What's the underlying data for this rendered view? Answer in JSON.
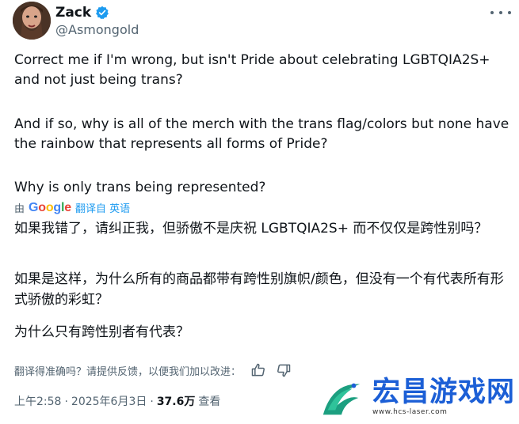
{
  "user": {
    "name": "Zack",
    "handle": "@Asmongold"
  },
  "tweet": {
    "paragraphs": [
      "Correct me if I'm wrong, but isn't Pride about celebrating LGBTQIA2S+ and not just being trans?",
      "And if so, why is all of the merch with the trans flag/colors but none have the rainbow that represents all forms of Pride?",
      "Why is only trans being represented?"
    ]
  },
  "translation": {
    "by_label": "由",
    "provider_letters": [
      "G",
      "o",
      "o",
      "g",
      "l",
      "e"
    ],
    "link_label": "翻译自 英语",
    "paragraphs": [
      "如果我错了，请纠正我，但骄傲不是庆祝 LGBTQIA2S+ 而不仅仅是跨性别吗？",
      "如果是这样，为什么所有的商品都带有跨性别旗帜/颜色，但没有一个有代表所有形式骄傲的彩虹？",
      "为什么只有跨性别者有代表？"
    ],
    "feedback_prompt": "翻译得准确吗？请提供反馈，以便我们加以改进："
  },
  "meta": {
    "time": "上午2:58",
    "date": "2025年6月3日",
    "separator": "·",
    "views_count": "37.6万",
    "views_label": "查看"
  },
  "watermark": {
    "title": "宏昌游戏网",
    "url": "www.hcs-laser.com"
  },
  "colors": {
    "text": "#0f1419",
    "secondary": "#536471",
    "verified": "#1d9bf0",
    "link": "#1d9bf0",
    "watermark_blue": "#1c5fd6"
  }
}
